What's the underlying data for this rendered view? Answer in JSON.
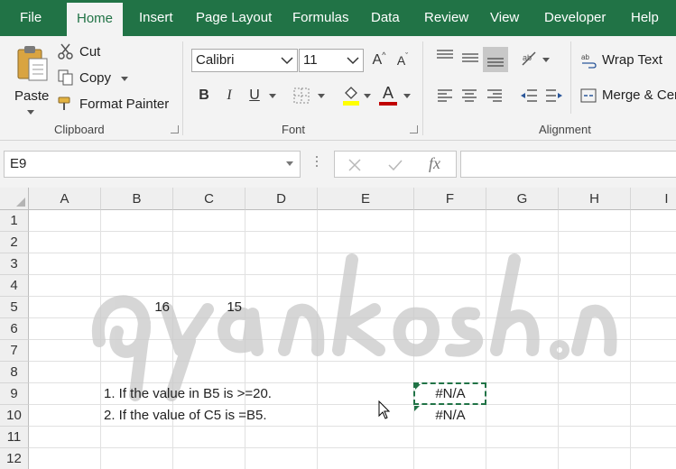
{
  "tabs": [
    {
      "label": "File"
    },
    {
      "label": "Home"
    },
    {
      "label": "Insert"
    },
    {
      "label": "Page Layout"
    },
    {
      "label": "Formulas"
    },
    {
      "label": "Data"
    },
    {
      "label": "Review"
    },
    {
      "label": "View"
    },
    {
      "label": "Developer"
    },
    {
      "label": "Help"
    }
  ],
  "active_tab": "Home",
  "clipboard": {
    "paste_label": "Paste",
    "cut_label": "Cut",
    "copy_label": "Copy",
    "format_painter_label": "Format Painter",
    "group_label": "Clipboard"
  },
  "font": {
    "font_name": "Calibri",
    "font_size": "11",
    "bold": "B",
    "italic": "I",
    "underline": "U",
    "grow": "A",
    "shrink": "A",
    "font_color_letter": "A",
    "group_label": "Font"
  },
  "alignment": {
    "wrap_text_label": "Wrap Text",
    "merge_label": "Merge & Cen",
    "group_label": "Alignment"
  },
  "formula_bar": {
    "name_box": "E9",
    "fx": "fx",
    "formula": ""
  },
  "columns": [
    "A",
    "B",
    "C",
    "D",
    "E",
    "F",
    "G",
    "H",
    "I"
  ],
  "rows": [
    "1",
    "2",
    "3",
    "4",
    "5",
    "6",
    "7",
    "8",
    "9",
    "10",
    "11",
    "12"
  ],
  "cells": {
    "B5": "16",
    "C5": "15",
    "B9": "1. If the value in B5 is >=20.",
    "B10": "2. If the value of C5 is =B5.",
    "F9": "#N/A",
    "F10": "#N/A"
  },
  "colors": {
    "accent": "#217346",
    "ribbon_bg": "#f3f3f3",
    "highlight_yellow": "#ffff00",
    "font_color_red": "#c00000"
  }
}
